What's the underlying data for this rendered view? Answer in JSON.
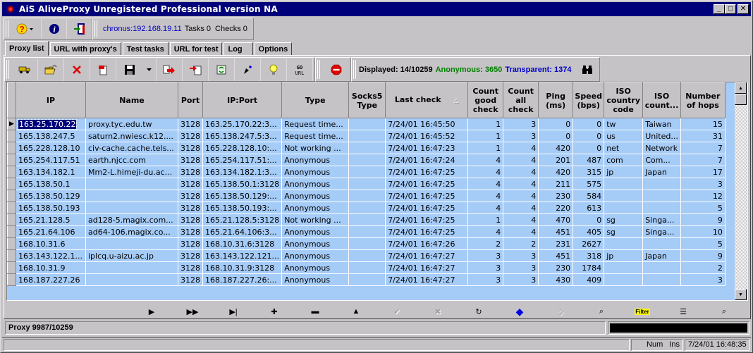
{
  "window": {
    "title": "AiS AliveProxy Unregistered Professional version NA",
    "controls": {
      "minimize": "_",
      "maximize": "□",
      "close": "✕"
    }
  },
  "topbar": {
    "buttons": [
      {
        "name": "help-menu-button",
        "icon": "help-icon"
      },
      {
        "name": "about-button",
        "icon": "info-icon"
      },
      {
        "name": "exit-button",
        "icon": "exit-door-icon"
      }
    ],
    "host": "chronus:192.168.19.11",
    "tasks": "Tasks 0",
    "checks": "Checks 0"
  },
  "tabs": [
    {
      "label": "Proxy list",
      "active": true
    },
    {
      "label": "URL with proxy's",
      "active": false
    },
    {
      "label": "Test tasks",
      "active": false
    },
    {
      "label": "URL for test",
      "active": false
    },
    {
      "label": "Log",
      "active": false
    },
    {
      "label": "Options",
      "active": false
    }
  ],
  "toolbar": {
    "buttons": [
      "truck-icon",
      "open-folder-icon",
      "delete-x-icon",
      "remove-page-icon",
      "save-disk-icon",
      "export-icon",
      "import-icon",
      "recycle-icon",
      "pin-icon",
      "lightbulb-icon",
      "go-url-icon",
      "stop-icon"
    ],
    "go_url_label": [
      "GO",
      "URL"
    ],
    "displayed_label": "Displayed: 14/10259",
    "anonymous_label": "Anonymous: 3650",
    "transparent_label": "Transparent: 1374",
    "colors": {
      "anonymous": "#008000",
      "transparent": "#0000c8"
    }
  },
  "grid": {
    "columns": [
      {
        "key": "ip",
        "label": "IP"
      },
      {
        "key": "name",
        "label": "Name"
      },
      {
        "key": "port",
        "label": "Port"
      },
      {
        "key": "ipport",
        "label": "IP:Port"
      },
      {
        "key": "type",
        "label": "Type"
      },
      {
        "key": "socks5",
        "label": "Socks5 Type"
      },
      {
        "key": "lastcheck",
        "label": "Last check",
        "sorted": "asc"
      },
      {
        "key": "good",
        "label": "Count good check"
      },
      {
        "key": "all",
        "label": "Count all check"
      },
      {
        "key": "ping",
        "label": "Ping (ms)"
      },
      {
        "key": "speed",
        "label": "Speed (bps)"
      },
      {
        "key": "iso",
        "label": "ISO country code"
      },
      {
        "key": "country",
        "label": "ISO count..."
      },
      {
        "key": "hops",
        "label": "Number of hops"
      }
    ],
    "rows": [
      [
        "163.25.170.22",
        "proxy.tyc.edu.tw",
        "3128",
        "163.25.170.22:3...",
        "Request time...",
        "",
        "7/24/01 16:45:50",
        "1",
        "3",
        "0",
        "0",
        "tw",
        "Taiwan",
        "15"
      ],
      [
        "165.138.247.5",
        "saturn2.nwiesc.k12....",
        "3128",
        "165.138.247.5:3...",
        "Request time...",
        "",
        "7/24/01 16:45:52",
        "1",
        "3",
        "0",
        "0",
        "us",
        "United...",
        "31"
      ],
      [
        "165.228.128.10",
        "civ-cache.cache.tels...",
        "3128",
        "165.228.128.10:...",
        "Not working ...",
        "",
        "7/24/01 16:47:23",
        "1",
        "4",
        "420",
        "0",
        "net",
        "Network",
        "7"
      ],
      [
        "165.254.117.51",
        "earth.njcc.com",
        "3128",
        "165.254.117.51:...",
        "Anonymous",
        "",
        "7/24/01 16:47:24",
        "4",
        "4",
        "201",
        "487",
        "com",
        "Com...",
        "7"
      ],
      [
        "163.134.182.1",
        "Mm2-L.himeji-du.ac...",
        "3128",
        "163.134.182.1:3...",
        "Anonymous",
        "",
        "7/24/01 16:47:25",
        "4",
        "4",
        "420",
        "315",
        "jp",
        "Japan",
        "17"
      ],
      [
        "165.138.50.1",
        "",
        "3128",
        "165.138.50.1:3128",
        "Anonymous",
        "",
        "7/24/01 16:47:25",
        "4",
        "4",
        "211",
        "575",
        "",
        "",
        "3"
      ],
      [
        "165.138.50.129",
        "",
        "3128",
        "165.138.50.129:...",
        "Anonymous",
        "",
        "7/24/01 16:47:25",
        "4",
        "4",
        "230",
        "584",
        "",
        "",
        "12"
      ],
      [
        "165.138.50.193",
        "",
        "3128",
        "165.138.50.193:...",
        "Anonymous",
        "",
        "7/24/01 16:47:25",
        "4",
        "4",
        "220",
        "613",
        "",
        "",
        "5"
      ],
      [
        "165.21.128.5",
        "ad128-5.magix.com...",
        "3128",
        "165.21.128.5:3128",
        "Not working ...",
        "",
        "7/24/01 16:47:25",
        "1",
        "4",
        "470",
        "0",
        "sg",
        "Singa...",
        "9"
      ],
      [
        "165.21.64.106",
        "ad64-106.magix.co...",
        "3128",
        "165.21.64.106:3...",
        "Anonymous",
        "",
        "7/24/01 16:47:25",
        "4",
        "4",
        "451",
        "405",
        "sg",
        "Singa...",
        "10"
      ],
      [
        "168.10.31.6",
        "",
        "3128",
        "168.10.31.6:3128",
        "Anonymous",
        "",
        "7/24/01 16:47:26",
        "2",
        "2",
        "231",
        "2627",
        "",
        "",
        "5"
      ],
      [
        "163.143.122.1...",
        "iplcq.u-aizu.ac.jp",
        "3128",
        "163.143.122.121...",
        "Anonymous",
        "",
        "7/24/01 16:47:27",
        "3",
        "3",
        "451",
        "318",
        "jp",
        "Japan",
        "9"
      ],
      [
        "168.10.31.9",
        "",
        "3128",
        "168.10.31.9:3128",
        "Anonymous",
        "",
        "7/24/01 16:47:27",
        "3",
        "3",
        "230",
        "1784",
        "",
        "",
        "2"
      ],
      [
        "168.187.227.26",
        "",
        "3128",
        "168.187.227.26:...",
        "Anonymous",
        "",
        "7/24/01 16:47:27",
        "3",
        "3",
        "430",
        "409",
        "",
        "",
        "3"
      ]
    ],
    "selected_row": 0,
    "colors": {
      "row_bg": "#a5cbf7",
      "selected_bg": "#00007b"
    }
  },
  "navigator": [
    {
      "name": "next-record",
      "glyph": "▶",
      "enabled": true
    },
    {
      "name": "next-page",
      "glyph": "▶▶",
      "enabled": true
    },
    {
      "name": "last-record",
      "glyph": "▶|",
      "enabled": true
    },
    {
      "name": "insert-record",
      "glyph": "✚",
      "enabled": true
    },
    {
      "name": "delete-record",
      "glyph": "▬",
      "enabled": true
    },
    {
      "name": "edit-record",
      "glyph": "▲",
      "enabled": true
    },
    {
      "name": "post-edit",
      "glyph": "✔",
      "enabled": false
    },
    {
      "name": "cancel-edit",
      "glyph": "✖",
      "enabled": false
    },
    {
      "name": "refresh-data",
      "glyph": "↻",
      "enabled": true
    },
    {
      "name": "bookmark",
      "glyph": "◆",
      "enabled": true
    },
    {
      "name": "goto-bookmark",
      "glyph": "◇",
      "enabled": false
    },
    {
      "name": "find",
      "glyph": "⌕",
      "enabled": true
    },
    {
      "name": "filter",
      "glyph": "Filter",
      "enabled": true
    },
    {
      "name": "print-list",
      "glyph": "☰",
      "enabled": true
    },
    {
      "name": "search-options",
      "glyph": "⌕",
      "enabled": true
    }
  ],
  "status": {
    "proxy_count": "Proxy 9987/10259",
    "progress": 0.0,
    "num": "Num",
    "ins": "Ins",
    "datetime": "7/24/01 16:48:35"
  }
}
